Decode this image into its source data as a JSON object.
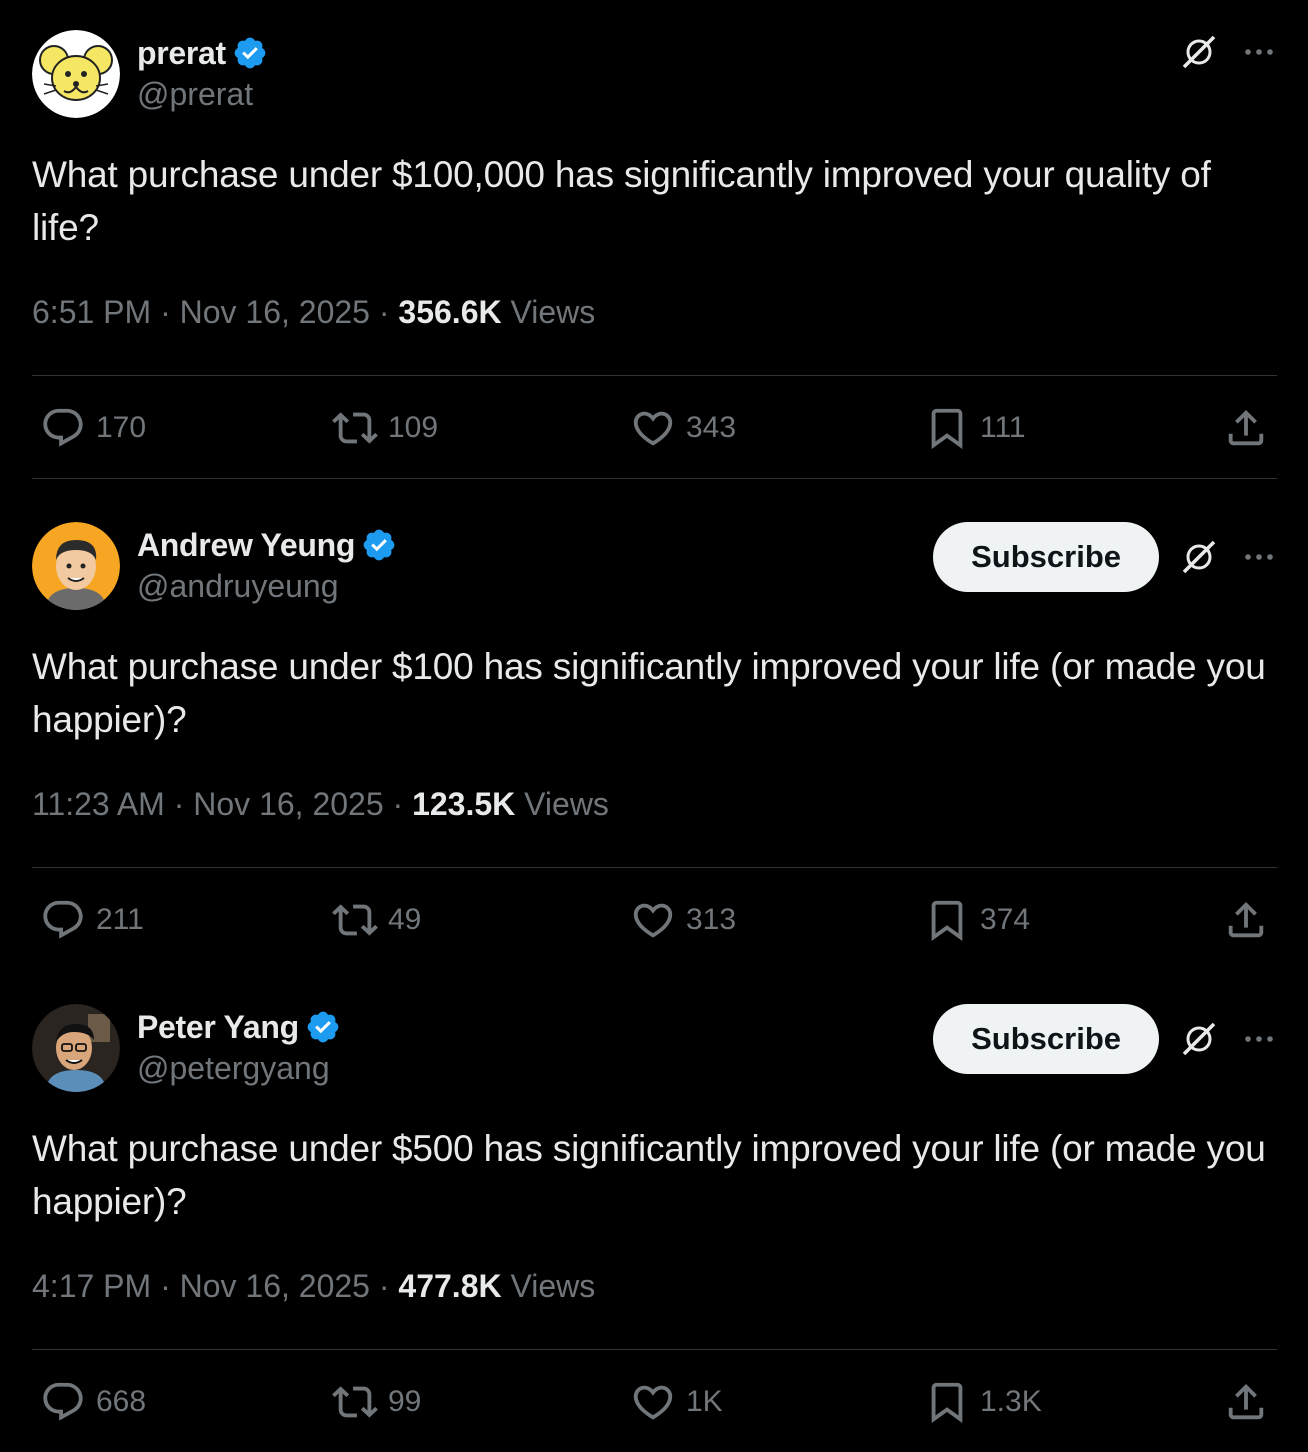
{
  "tweets": [
    {
      "name": "prerat",
      "handle": "@prerat",
      "show_subscribe": false,
      "text": "What purchase under $100,000 has significantly improved your quality of life?",
      "time": "6:51 PM",
      "date": "Nov 16, 2025",
      "views_count": "356.6K",
      "views_label": "Views",
      "replies": "170",
      "reposts": "109",
      "likes": "343",
      "bookmarks": "111"
    },
    {
      "name": "Andrew Yeung",
      "handle": "@andruyeung",
      "show_subscribe": true,
      "subscribe_label": "Subscribe",
      "text": "What purchase under $100 has significantly improved your life (or made you happier)?",
      "time": "11:23 AM",
      "date": "Nov 16, 2025",
      "views_count": "123.5K",
      "views_label": "Views",
      "replies": "211",
      "reposts": "49",
      "likes": "313",
      "bookmarks": "374"
    },
    {
      "name": "Peter Yang",
      "handle": "@petergyang",
      "show_subscribe": true,
      "subscribe_label": "Subscribe",
      "text": "What purchase under $500 has significantly improved your life (or made you happier)?",
      "time": "4:17 PM",
      "date": "Nov 16, 2025",
      "views_count": "477.8K",
      "views_label": "Views",
      "replies": "668",
      "reposts": "99",
      "likes": "1K",
      "bookmarks": "1.3K"
    }
  ],
  "colors": {
    "background": "#000000",
    "text": "#e7e9ea",
    "secondary": "#71767b",
    "verified": "#1d9bf0",
    "divider": "#2f3336",
    "subscribe_bg": "#eff3f4"
  },
  "icons": [
    "verified-badge-icon",
    "grok-icon",
    "more-icon",
    "reply-icon",
    "repost-icon",
    "like-icon",
    "bookmark-icon",
    "share-icon"
  ]
}
